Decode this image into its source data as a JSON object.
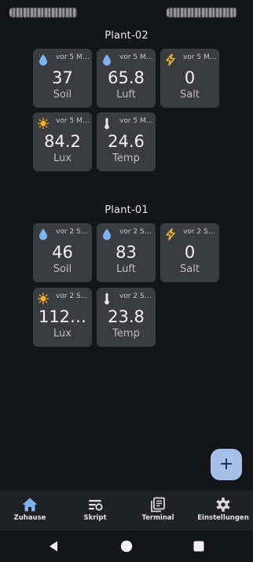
{
  "colors": {
    "background": "#141518",
    "tile": "#3b3c40",
    "water_icon": "#7fb2f0",
    "bolt_icon": "#e8b93a",
    "sun_icon": "#f0b429",
    "therm_icon": "#e8e8ea",
    "fab": "#a9c1ea",
    "nav_active": "#7fb2f0"
  },
  "groups": [
    {
      "title": "Plant-02",
      "tiles": [
        {
          "icon": "water-drop-icon",
          "time": "vor 5 Mi…",
          "value": "37",
          "label": "Soil"
        },
        {
          "icon": "water-drop-icon",
          "time": "vor 5 Mi…",
          "value": "65.8",
          "label": "Luft"
        },
        {
          "icon": "lightning-bolt-icon",
          "time": "vor 5 Mi…",
          "value": "0",
          "label": "Salt"
        },
        {
          "icon": "sun-icon",
          "time": "vor 5 Mi…",
          "value": "84.2",
          "label": "Lux"
        },
        {
          "icon": "thermometer-icon",
          "time": "vor 5 Mi…",
          "value": "24.6",
          "label": "Temp"
        }
      ]
    },
    {
      "title": "Plant-01",
      "tiles": [
        {
          "icon": "water-drop-icon",
          "time": "vor 2 Se…",
          "value": "46",
          "label": "Soil"
        },
        {
          "icon": "water-drop-icon",
          "time": "vor 2 Se…",
          "value": "83",
          "label": "Luft"
        },
        {
          "icon": "lightning-bolt-icon",
          "time": "vor 2 Se…",
          "value": "0",
          "label": "Salt"
        },
        {
          "icon": "sun-icon",
          "time": "vor 2 Se…",
          "value": "112…",
          "label": "Lux"
        },
        {
          "icon": "thermometer-icon",
          "time": "vor 2 Se…",
          "value": "23.8",
          "label": "Temp"
        }
      ]
    }
  ],
  "fab": {
    "label": "+"
  },
  "nav": {
    "items": [
      {
        "label": "Zuhause",
        "icon": "home-icon",
        "active": true
      },
      {
        "label": "Skript",
        "icon": "script-icon",
        "active": false
      },
      {
        "label": "Terminal",
        "icon": "terminal-icon",
        "active": false
      },
      {
        "label": "Einstellungen",
        "icon": "gear-icon",
        "active": false
      }
    ]
  }
}
